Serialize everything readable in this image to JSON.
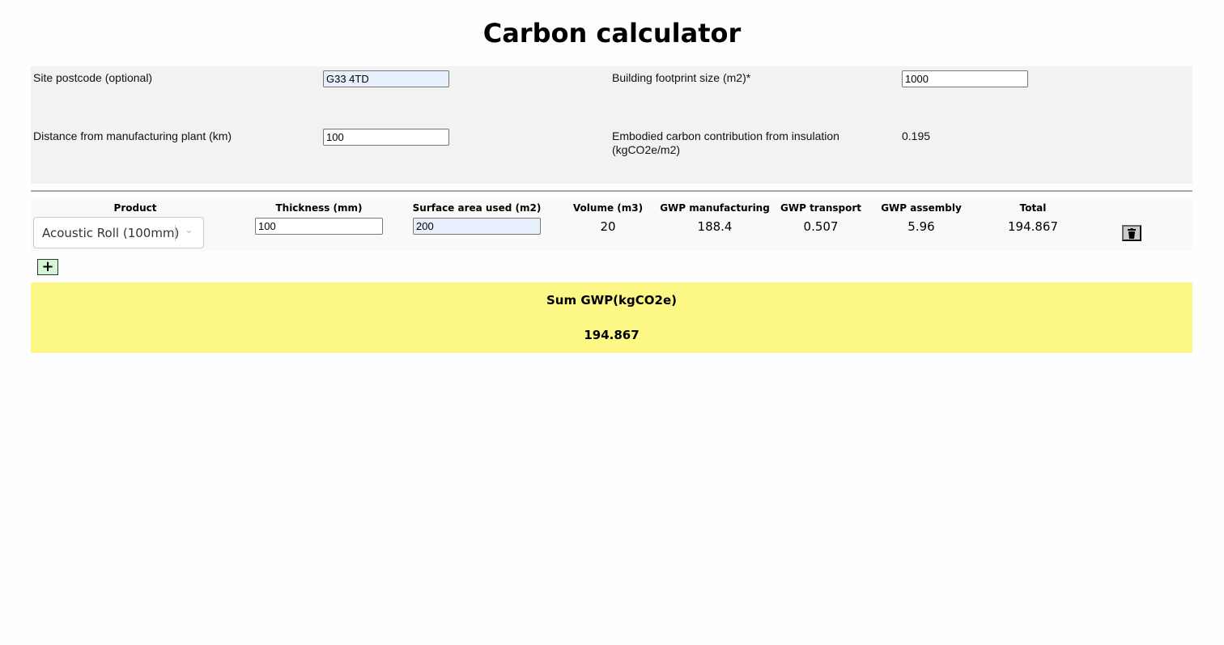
{
  "title": "Carbon calculator",
  "site": {
    "postcode_label": "Site postcode (optional)",
    "postcode_value": "G33 4TD",
    "footprint_label": "Building footprint size (m2)*",
    "footprint_value": "1000",
    "distance_label": "Distance from manufacturing plant (km)",
    "distance_value": "100",
    "embodied_label_1": "Embodied carbon contribution from insulation",
    "embodied_label_2": "(kgCO2e/m2)",
    "embodied_value": "0.195"
  },
  "table": {
    "headers": [
      "Product",
      "Thickness (mm)",
      "Surface area used (m2)",
      "Volume (m3)",
      "GWP manufacturing",
      "GWP transport",
      "GWP assembly",
      "Total"
    ],
    "rows": [
      {
        "product": "Acoustic Roll (100mm)",
        "thickness": "100",
        "area": "200",
        "volume": "20",
        "gwp_manufacturing": "188.4",
        "gwp_transport": "0.507",
        "gwp_assembly": "5.96",
        "total": "194.867"
      }
    ]
  },
  "add_label": "+",
  "sum": {
    "label": "Sum GWP(kgCO2e)",
    "value": "194.867"
  },
  "colors": {
    "panel": "#f2f2f0",
    "sum_bg": "#fdf885",
    "add_bg": "#d4f5d4",
    "focused_input": "#e8f0fe"
  }
}
